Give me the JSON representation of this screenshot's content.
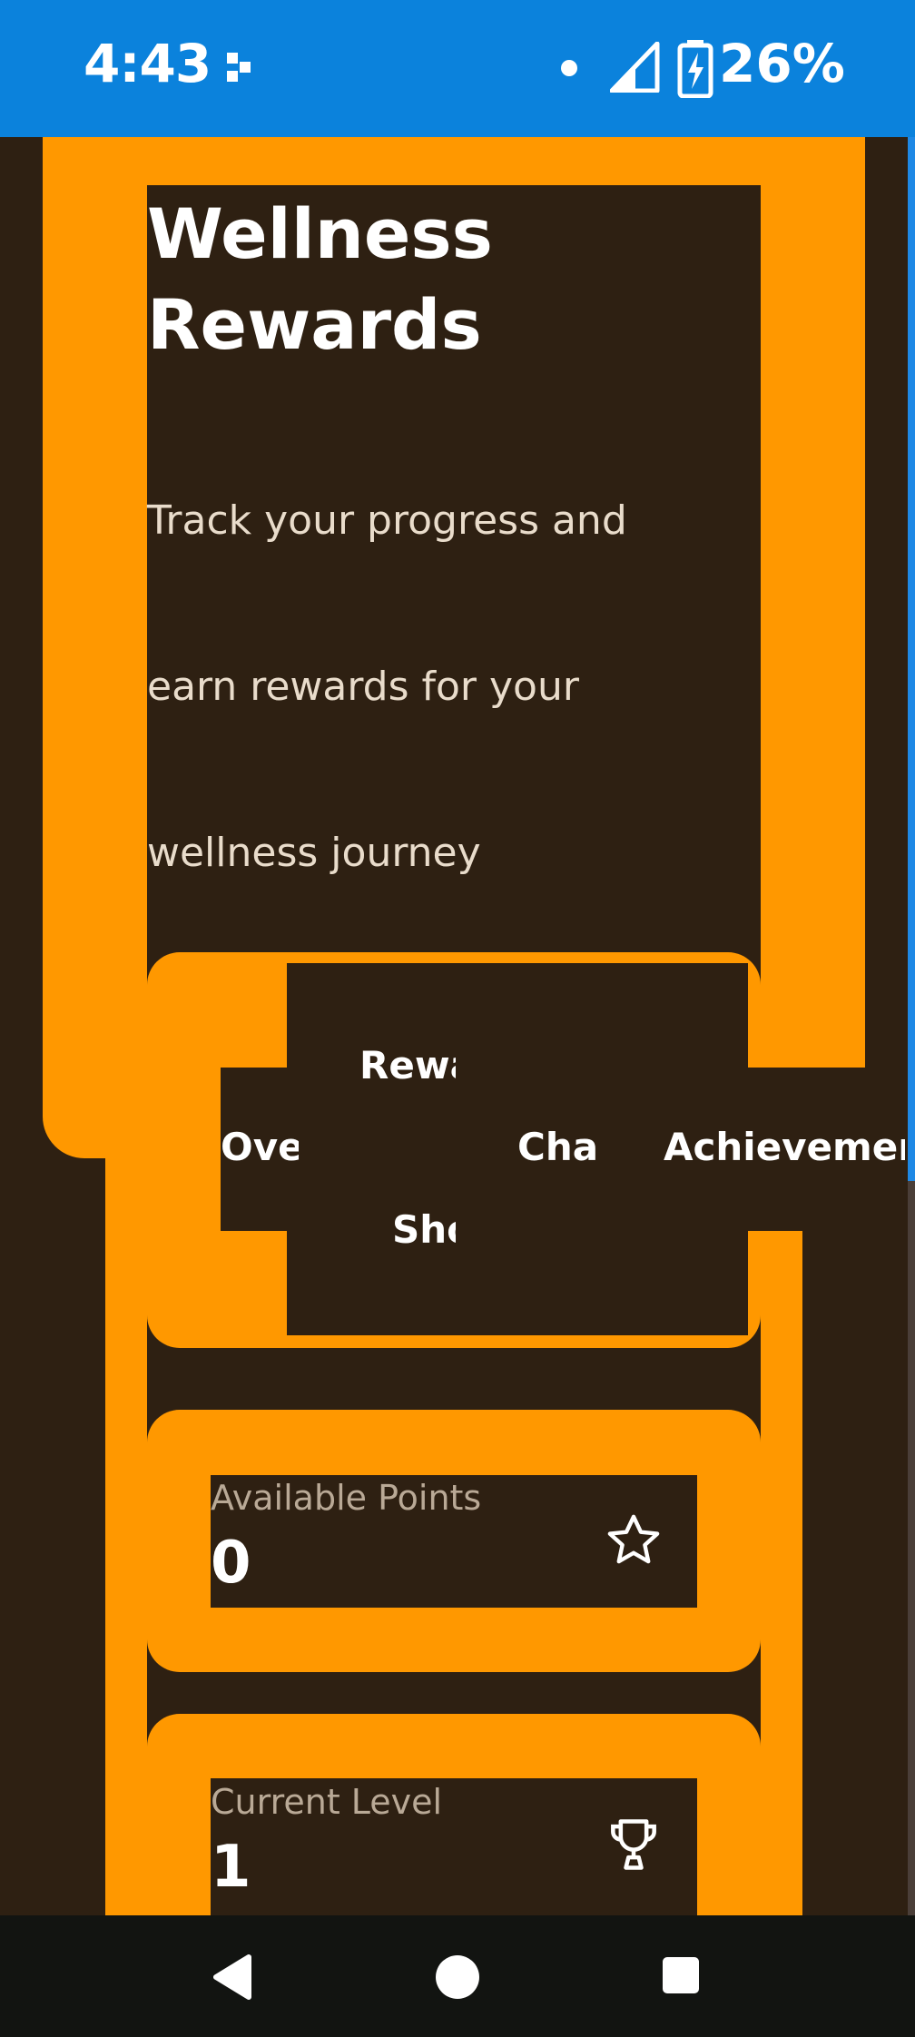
{
  "status_bar": {
    "time": "4:43",
    "battery_percent": "26%",
    "left_icon": "media-cast-icon",
    "icons": [
      "dot-icon",
      "signal-icon",
      "battery-charging-icon"
    ]
  },
  "header": {
    "title_line1": "Wellness",
    "title_line2": "Rewards",
    "subtitle": "Track your progress and earn rewards for your wellness journey"
  },
  "tabs": [
    {
      "label": "Overview"
    },
    {
      "label": "Rewards"
    },
    {
      "label": "Shop"
    },
    {
      "label": "Challenges"
    },
    {
      "label": "Achievements"
    }
  ],
  "cards": [
    {
      "label": "Available Points",
      "value": "0",
      "icon": "star-icon"
    },
    {
      "label": "Current Level",
      "value": "1",
      "icon": "trophy-icon"
    }
  ],
  "navigation": {
    "buttons": [
      "back-icon",
      "home-icon",
      "recents-icon"
    ]
  },
  "colors": {
    "accent": "#ff9800",
    "background": "#2e2012",
    "status_bar": "#0b82dc",
    "nav_bar": "#121411"
  }
}
